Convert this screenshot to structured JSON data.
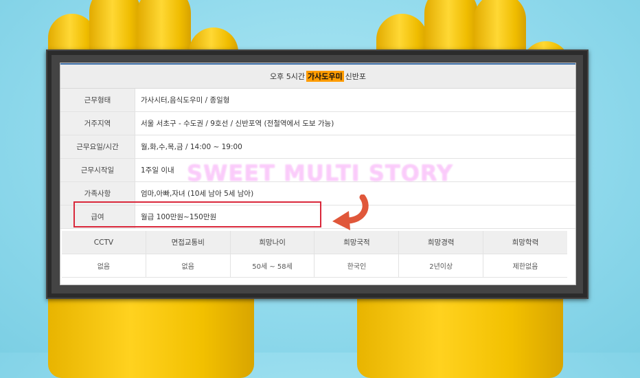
{
  "header": {
    "prefix": "오후 5시간",
    "highlight": "가사도우미",
    "suffix": "신반포"
  },
  "details": [
    {
      "label": "근무형태",
      "value": "가사시터,음식도우미 / 종일형"
    },
    {
      "label": "거주지역",
      "value": "서울 서초구 - 수도권 / 9호선 / 신반포역 (전철역에서 도보 가능)"
    },
    {
      "label": "근무요일/시간",
      "value": "월,화,수,목,금 / 14:00 ~ 19:00"
    },
    {
      "label": "근무시작일",
      "value": "1주일 이내"
    },
    {
      "label": "가족사항",
      "value": "엄마,아빠,자녀 (10세 남아 5세 남아)"
    },
    {
      "label": "급여",
      "value": "월급 100만원~150만원"
    }
  ],
  "requirements": {
    "headers": [
      "CCTV",
      "면접교통비",
      "희망나이",
      "희망국적",
      "희망경력",
      "희망학력"
    ],
    "values": [
      "없음",
      "없음",
      "50세 ~ 58세",
      "한국인",
      "2년이상",
      "제한없음"
    ]
  },
  "watermark": "SWEET MULTI STORY",
  "colors": {
    "highlight": "#ff9c00",
    "callout_border": "#d9273a",
    "arrow": "#e0573a",
    "background": "#8fd9ec",
    "glove": "#ffd21f"
  },
  "icons": {
    "arrow": "curved-arrow-left-icon"
  }
}
